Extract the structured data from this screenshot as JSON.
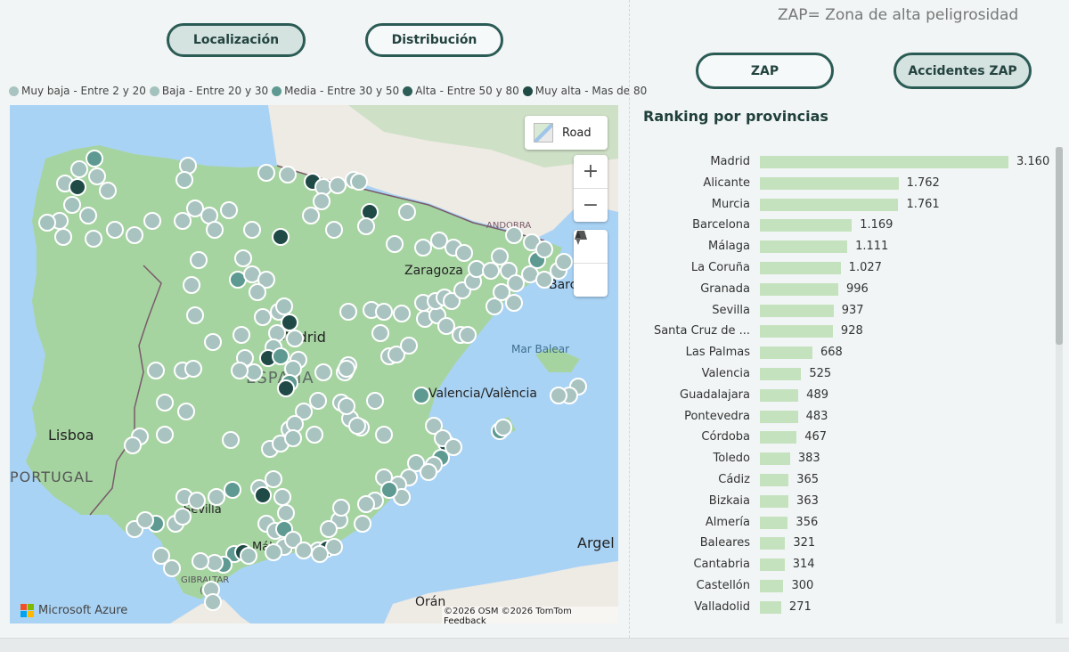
{
  "nav": {
    "localizacion": "Localización",
    "distribucion": "Distribución"
  },
  "legend": [
    {
      "label": "Muy baja - Entre 2 y 20",
      "color": "#a9c4c0"
    },
    {
      "label": "Baja - Entre 20 y 30",
      "color": "#a3c2bd"
    },
    {
      "label": "Media - Entre 30 y 50",
      "color": "#5e9a91"
    },
    {
      "label": "Alta - Entre 50 y 80",
      "color": "#2d5d57"
    },
    {
      "label": "Muy alta - Mas de 80",
      "color": "#1f4a45"
    }
  ],
  "map": {
    "road_label": "Road",
    "provider": "Microsoft Azure",
    "attribution": "©2026 OSM  ©2026 TomTom",
    "feedback": "Feedback",
    "labels": {
      "madrid": "Madrid",
      "espana": "ESPAÑA",
      "zaragoza": "Zaragoza",
      "valencia": "Valencia/València",
      "sevilla": "Sevilla",
      "malaga": "Málaga",
      "lisboa": "Lisboa",
      "portugal": "PORTUGAL",
      "andorra": "ANDORRA",
      "mar_balear": "Mar Balear",
      "argel": "Argel",
      "oran": "Orán",
      "barce": "Barce",
      "gibraltar": "GIBRALTAR",
      "uk": "(UK)"
    },
    "colors": {
      "sea": "#a9d3f5",
      "land": "#a6d4a1",
      "foreign_land": "#eeeae4"
    }
  },
  "right": {
    "zap_note": "ZAP= Zona de alta peligrosidad",
    "zap_button": "ZAP",
    "accidentes_button": "Accidentes ZAP",
    "ranking_title": "Ranking por provincias"
  },
  "chart_data": {
    "type": "bar",
    "orientation": "horizontal",
    "title": "Ranking por provincias",
    "categories": [
      "Madrid",
      "Alicante",
      "Murcia",
      "Barcelona",
      "Málaga",
      "La Coruña",
      "Granada",
      "Sevilla",
      "Santa Cruz de ...",
      "Las Palmas",
      "Valencia",
      "Guadalajara",
      "Pontevedra",
      "Córdoba",
      "Toledo",
      "Cádiz",
      "Bizkaia",
      "Almería",
      "Baleares",
      "Cantabria",
      "Castellón",
      "Valladolid"
    ],
    "values": [
      3160,
      1762,
      1761,
      1169,
      1111,
      1027,
      996,
      937,
      928,
      668,
      525,
      489,
      483,
      467,
      383,
      365,
      363,
      356,
      321,
      314,
      300,
      271
    ],
    "value_labels": [
      "3.160",
      "1.762",
      "1.761",
      "1.169",
      "1.111",
      "1.027",
      "996",
      "937",
      "928",
      "668",
      "525",
      "489",
      "483",
      "467",
      "383",
      "365",
      "363",
      "356",
      "321",
      "314",
      "300",
      "271"
    ],
    "bar_color": "#c5e2be"
  }
}
